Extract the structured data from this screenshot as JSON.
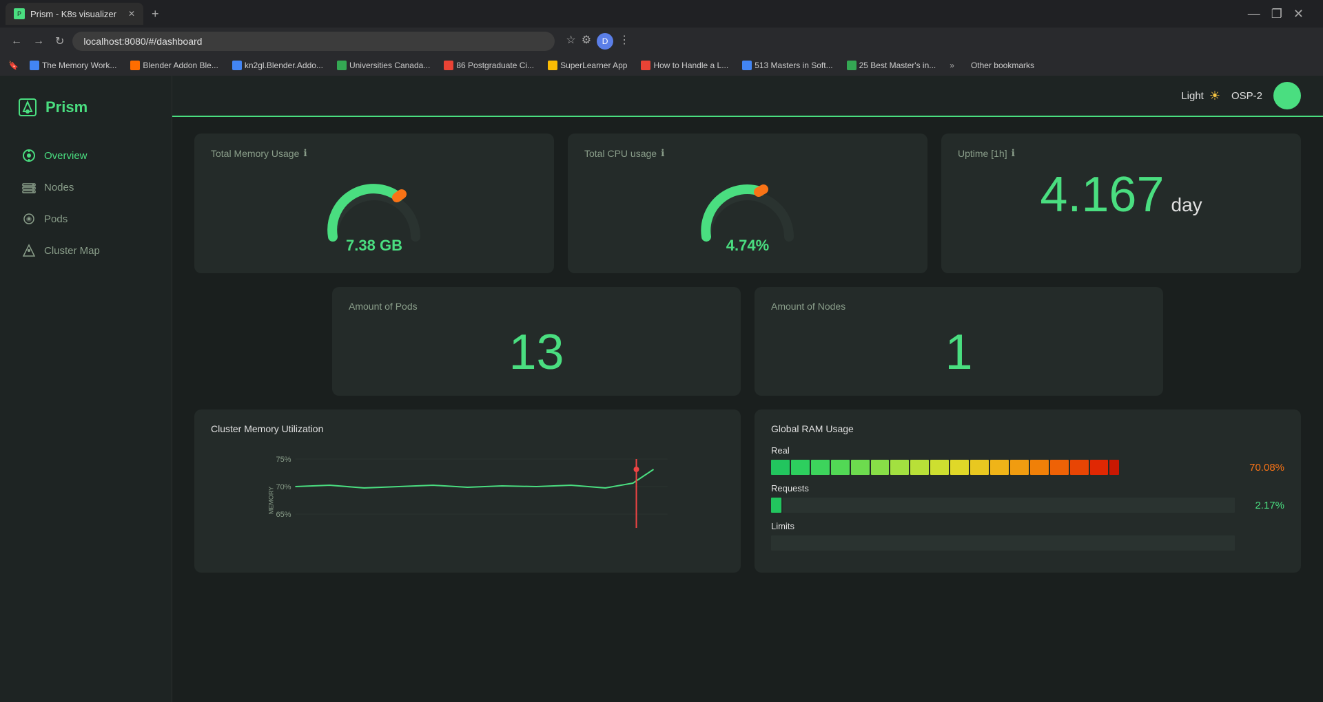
{
  "browser": {
    "tab_title": "Prism - K8s visualizer",
    "url": "localhost:8080/#/dashboard",
    "bookmarks": [
      {
        "label": "The Memory Work...",
        "color": "#4285f4"
      },
      {
        "label": "Blender Addon Ble...",
        "color": "#ff6d00"
      },
      {
        "label": "kn2gl.Blender.Addo...",
        "color": "#4285f4"
      },
      {
        "label": "Universities Canada...",
        "color": "#34a853"
      },
      {
        "label": "86 Postgraduate Ci...",
        "color": "#ea4335"
      },
      {
        "label": "SuperLearner App",
        "color": "#fbbc04"
      },
      {
        "label": "How to Handle a L...",
        "color": "#ea4335"
      },
      {
        "label": "513 Masters in Soft...",
        "color": "#4285f4"
      },
      {
        "label": "25 Best Master's in...",
        "color": "#34a853"
      },
      {
        "label": "Other bookmarks",
        "color": "#888"
      }
    ]
  },
  "app": {
    "logo_text": "Prism",
    "nav_items": [
      {
        "label": "Overview",
        "icon": "overview-icon",
        "active": true
      },
      {
        "label": "Nodes",
        "icon": "nodes-icon",
        "active": false
      },
      {
        "label": "Pods",
        "icon": "pods-icon",
        "active": false
      },
      {
        "label": "Cluster Map",
        "icon": "cluster-map-icon",
        "active": false
      }
    ],
    "header": {
      "theme_label": "Light",
      "username": "OSP-2"
    }
  },
  "dashboard": {
    "metrics": {
      "memory": {
        "title": "Total Memory Usage",
        "value": "7.38 GB",
        "percentage": 68
      },
      "cpu": {
        "title": "Total CPU usage",
        "value": "4.74%",
        "percentage": 47
      },
      "uptime": {
        "title": "Uptime [1h]",
        "number": "4.167",
        "unit": "day"
      }
    },
    "counts": {
      "pods": {
        "title": "Amount of Pods",
        "value": "13"
      },
      "nodes": {
        "title": "Amount of Nodes",
        "value": "1"
      }
    },
    "charts": {
      "memory_utilization": {
        "title": "Cluster Memory Utilization",
        "y_labels": [
          "75%",
          "70%",
          "65%"
        ],
        "x_label": "MEMORY"
      },
      "ram_usage": {
        "title": "Global RAM Usage",
        "sections": [
          {
            "label": "Real",
            "percentage": "70.08%",
            "color_class": "orange"
          },
          {
            "label": "Requests",
            "percentage": "2.17%",
            "color_class": "green"
          },
          {
            "label": "Limits",
            "percentage": "",
            "color_class": "green"
          }
        ]
      }
    }
  }
}
